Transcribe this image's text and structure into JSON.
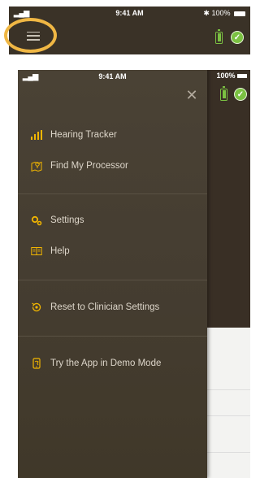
{
  "status_bar": {
    "signal": "▂▄▆",
    "time": "9:41 AM",
    "battery_text": "✱ 100%",
    "battery_text_under": "100%"
  },
  "menu": {
    "close_glyph": "✕",
    "items": [
      {
        "label": "Hearing Tracker",
        "icon": "signal-bars-icon"
      },
      {
        "label": "Find My Processor",
        "icon": "map-location-icon"
      },
      {
        "label": "Settings",
        "icon": "settings-key-icon"
      },
      {
        "label": "Help",
        "icon": "book-icon"
      },
      {
        "label": "Reset to Clinician Settings",
        "icon": "reset-icon"
      },
      {
        "label": "Try the App in Demo Mode",
        "icon": "demo-phone-icon"
      }
    ]
  },
  "colors": {
    "accent": "#f2b600",
    "highlight": "#f0b744",
    "ok_green": "#7bc142",
    "drawer_bg": "#453d31"
  }
}
